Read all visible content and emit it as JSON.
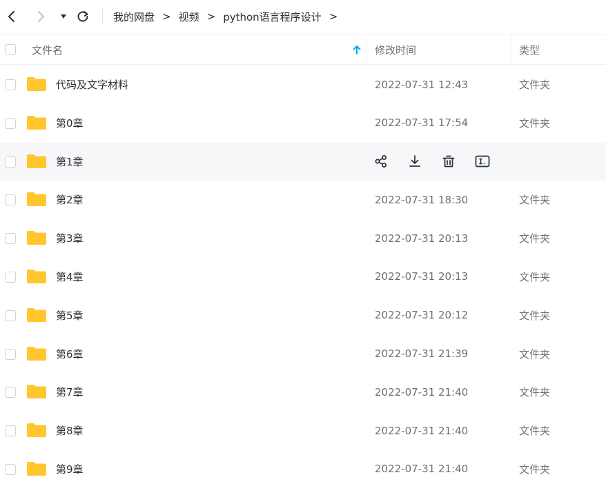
{
  "breadcrumb": [
    "我的网盘",
    "视频",
    "python语言程序设计"
  ],
  "breadcrumb_separator": ">",
  "columns": {
    "name": "文件名",
    "mtime": "修改时间",
    "type": "类型"
  },
  "colors": {
    "folder": "#FFC62E",
    "sort_arrow": "#06A7FF",
    "hover_row": "#F6F7F9"
  },
  "icons": {
    "back": "chevron-left-icon",
    "forward": "chevron-right-icon",
    "dropdown": "caret-down-icon",
    "refresh": "refresh-icon",
    "sort": "arrow-up-icon",
    "folder": "folder-icon",
    "row_actions": [
      "share-icon",
      "download-icon",
      "delete-icon",
      "rename-icon"
    ]
  },
  "files": [
    {
      "name": "代码及文字材料",
      "mtime": "2022-07-31 12:43",
      "type": "文件夹"
    },
    {
      "name": "第0章",
      "mtime": "2022-07-31 17:54",
      "type": "文件夹"
    },
    {
      "name": "第1章",
      "mtime": "",
      "type": "",
      "hovered": true
    },
    {
      "name": "第2章",
      "mtime": "2022-07-31 18:30",
      "type": "文件夹"
    },
    {
      "name": "第3章",
      "mtime": "2022-07-31 20:13",
      "type": "文件夹"
    },
    {
      "name": "第4章",
      "mtime": "2022-07-31 20:13",
      "type": "文件夹"
    },
    {
      "name": "第5章",
      "mtime": "2022-07-31 20:12",
      "type": "文件夹"
    },
    {
      "name": "第6章",
      "mtime": "2022-07-31 21:39",
      "type": "文件夹"
    },
    {
      "name": "第7章",
      "mtime": "2022-07-31 21:40",
      "type": "文件夹"
    },
    {
      "name": "第8章",
      "mtime": "2022-07-31 21:40",
      "type": "文件夹"
    },
    {
      "name": "第9章",
      "mtime": "2022-07-31 21:40",
      "type": "文件夹"
    }
  ]
}
